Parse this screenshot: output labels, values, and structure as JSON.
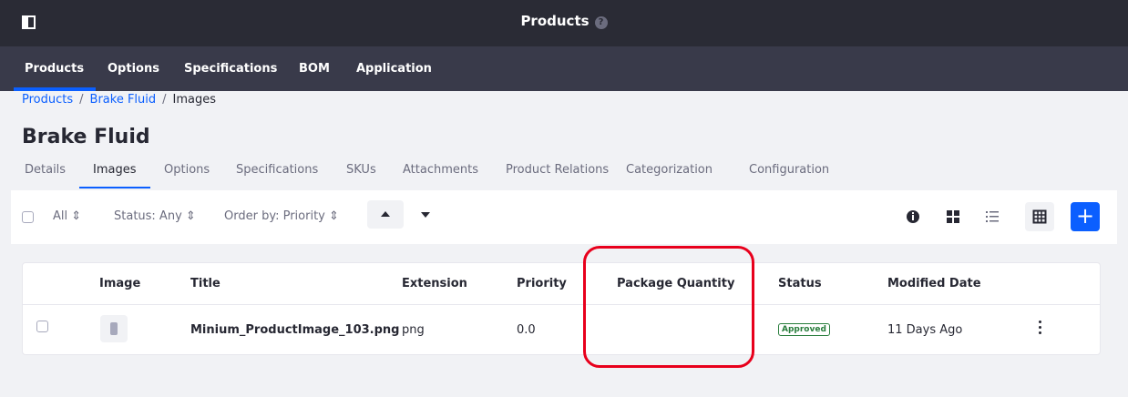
{
  "header": {
    "title": "Products"
  },
  "nav": {
    "tabs": [
      "Products",
      "Options",
      "Specifications",
      "BOM",
      "Application"
    ]
  },
  "breadcrumb": {
    "items": [
      "Products",
      "Brake Fluid",
      "Images"
    ],
    "separator": "/"
  },
  "page": {
    "title": "Brake Fluid"
  },
  "subtabs": [
    "Details",
    "Images",
    "Options",
    "Specifications",
    "SKUs",
    "Attachments",
    "Product Relations",
    "Categorization",
    "Configuration"
  ],
  "toolbar": {
    "filter_all": "All",
    "status_filter": "Status: Any",
    "order_by": "Order by: Priority",
    "add_label": "+"
  },
  "table": {
    "columns": [
      "Image",
      "Title",
      "Extension",
      "Priority",
      "Package Quantity",
      "Status",
      "Modified Date"
    ],
    "rows": [
      {
        "title": "Minium_ProductImage_103.png",
        "extension": "png",
        "priority": "0.0",
        "package_quantity": "",
        "status": "Approved",
        "modified": "11 Days Ago"
      }
    ]
  },
  "colors": {
    "accent": "#0b5fff",
    "header_bg": "#2a2b35",
    "nav_bg": "#393a4a",
    "status_approved": "#287d3c",
    "highlight": "#e8001c"
  }
}
